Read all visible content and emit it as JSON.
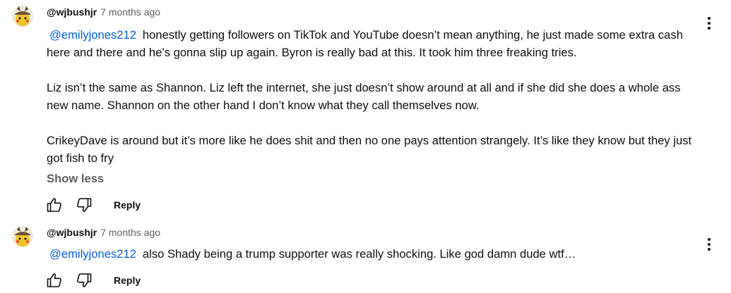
{
  "comments": [
    {
      "author": "@wjbushjr",
      "time": "7 months ago",
      "mention": "@emilyjones212",
      "paragraphs": [
        "honestly getting followers on TikTok and YouTube doesn’t mean anything, he just made some extra cash here and there and he’s gonna slip up again. Byron is really bad at this. It took him three freaking tries.",
        "Liz isn’t the same as Shannon. Liz left the internet, she just doesn’t show around at all and if she did she does a whole ass new name. Shannon on the other hand I don’t know what they call themselves now.",
        "CrikeyDave is around but it’s more like he does shit and then no one pays attention strangely. It’s like they know but they just got fish to fry"
      ],
      "show_less_label": "Show less",
      "reply_label": "Reply"
    },
    {
      "author": "@wjbushjr",
      "time": "7 months ago",
      "mention": "@emilyjones212",
      "paragraphs": [
        "also Shady being a trump supporter was really shocking. Like god damn dude wtf…"
      ],
      "reply_label": "Reply"
    }
  ],
  "icons": {
    "like": "thumb-up-icon",
    "dislike": "thumb-down-icon",
    "menu": "more-vert-icon",
    "avatar": "pikachu-detective-avatar"
  },
  "colors": {
    "text": "#0f0f0f",
    "secondary": "#606060",
    "link": "#065fd4"
  }
}
